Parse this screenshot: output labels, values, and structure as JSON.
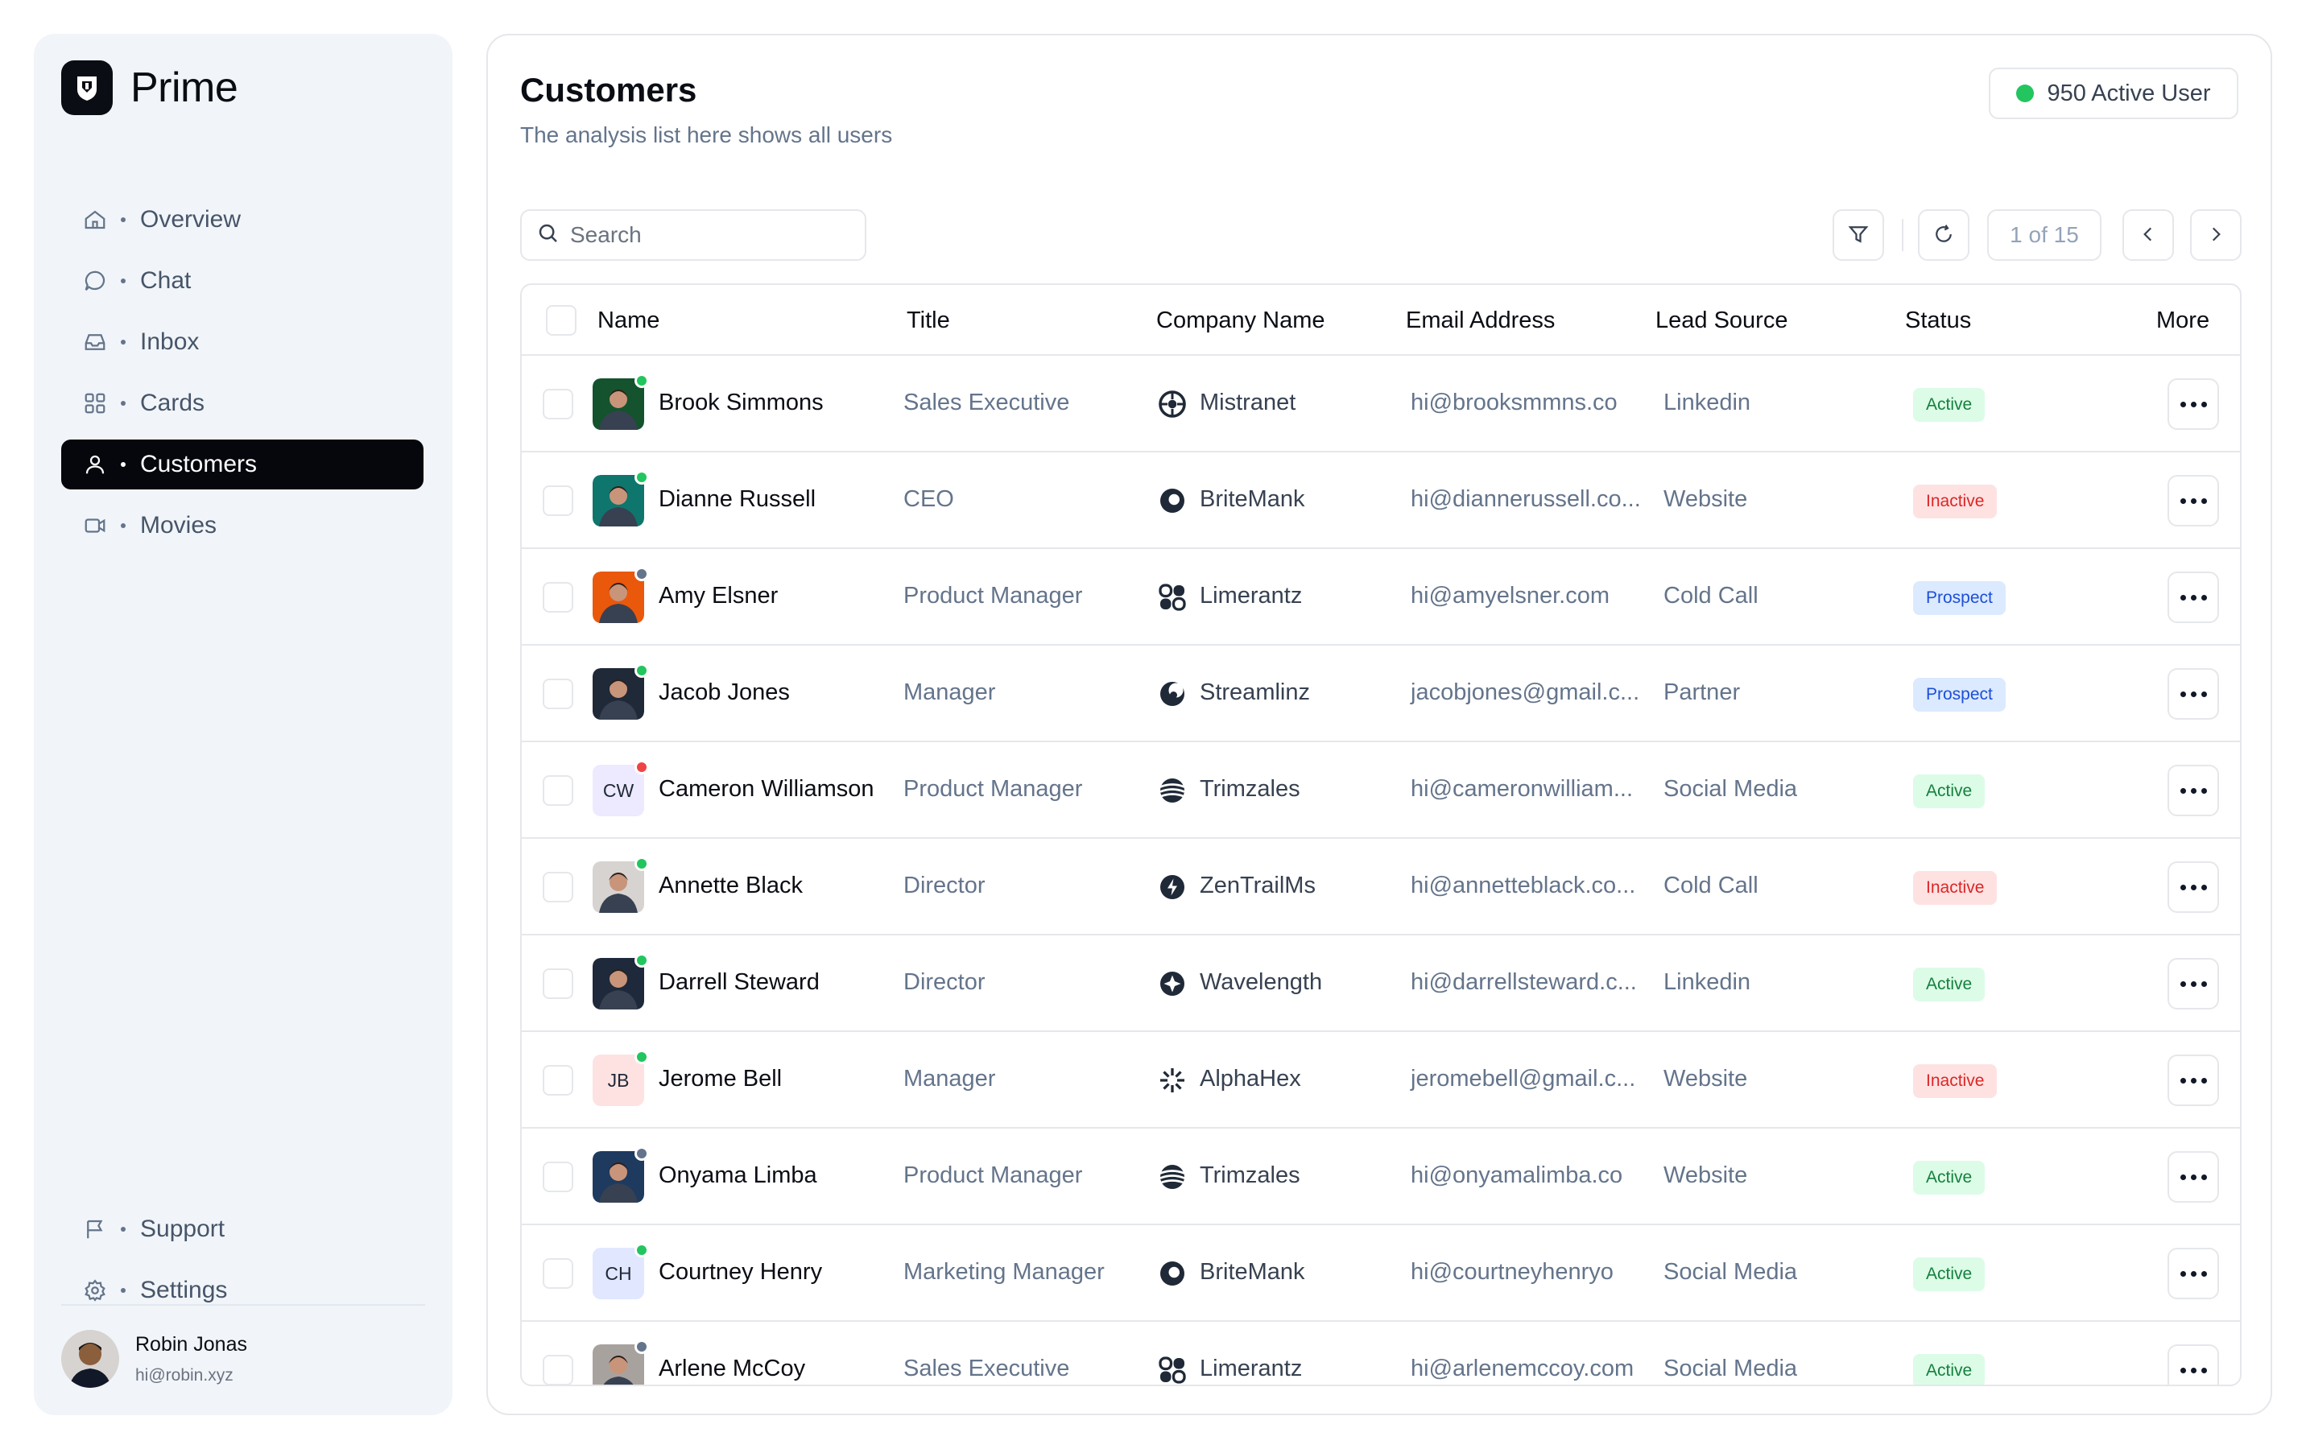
{
  "app": {
    "name": "Prime"
  },
  "sidebar": {
    "nav": [
      {
        "label": "Overview",
        "icon": "home-icon",
        "active": false
      },
      {
        "label": "Chat",
        "icon": "chat-bubble-icon",
        "active": false
      },
      {
        "label": "Inbox",
        "icon": "inbox-icon",
        "active": false
      },
      {
        "label": "Cards",
        "icon": "grid-icon",
        "active": false
      },
      {
        "label": "Customers",
        "icon": "user-icon",
        "active": true
      },
      {
        "label": "Movies",
        "icon": "video-camera-icon",
        "active": false
      }
    ],
    "bottom": [
      {
        "label": "Support",
        "icon": "flag-icon"
      },
      {
        "label": "Settings",
        "icon": "gear-icon"
      }
    ],
    "profile": {
      "name": "Robin Jonas",
      "email": "hi@robin.xyz"
    }
  },
  "header": {
    "title": "Customers",
    "subtitle": "The analysis list here shows all users",
    "active_users": "950 Active User"
  },
  "toolbar": {
    "search_placeholder": "Search",
    "pager": "1 of 15"
  },
  "table": {
    "columns": [
      "Name",
      "Title",
      "Company Name",
      "Email Address",
      "Lead Source",
      "Status",
      "More"
    ],
    "rows": [
      {
        "name": "Brook Simmons",
        "title": "Sales Executive",
        "company": "Mistranet",
        "email": "hi@brooksmmns.co",
        "lead": "Linkedin",
        "status": "Active",
        "online": "online",
        "initials": "",
        "avatar_bg": "#14532d"
      },
      {
        "name": "Dianne Russell",
        "title": "CEO",
        "company": "BriteMank",
        "email": "hi@diannerussell.co...",
        "lead": "Website",
        "status": "Inactive",
        "online": "online",
        "initials": "",
        "avatar_bg": "#0f766e"
      },
      {
        "name": "Amy Elsner",
        "title": "Product Manager",
        "company": "Limerantz",
        "email": "hi@amyelsner.com",
        "lead": "Cold Call",
        "status": "Prospect",
        "online": "away",
        "initials": "",
        "avatar_bg": "#ea580c"
      },
      {
        "name": "Jacob Jones",
        "title": "Manager",
        "company": "Streamlinz",
        "email": "jacobjones@gmail.c...",
        "lead": "Partner",
        "status": "Prospect",
        "online": "online",
        "initials": "",
        "avatar_bg": "#1f2937"
      },
      {
        "name": "Cameron Williamson",
        "title": "Product Manager",
        "company": "Trimzales",
        "email": "hi@cameronwilliam...",
        "lead": "Social Media",
        "status": "Active",
        "online": "busy",
        "initials": "CW",
        "avatar_bg": "#ede9fe"
      },
      {
        "name": "Annette Black",
        "title": "Director",
        "company": "ZenTrailMs",
        "email": "hi@annetteblack.co...",
        "lead": "Cold Call",
        "status": "Inactive",
        "online": "online",
        "initials": "",
        "avatar_bg": "#d6d3d1"
      },
      {
        "name": "Darrell Steward",
        "title": "Director",
        "company": "Wavelength",
        "email": "hi@darrellsteward.c...",
        "lead": "Linkedin",
        "status": "Active",
        "online": "online",
        "initials": "",
        "avatar_bg": "#1e293b"
      },
      {
        "name": "Jerome Bell",
        "title": "Manager",
        "company": "AlphaHex",
        "email": "jeromebell@gmail.c...",
        "lead": "Website",
        "status": "Inactive",
        "online": "online",
        "initials": "JB",
        "avatar_bg": "#fee2e2"
      },
      {
        "name": "Onyama Limba",
        "title": "Product Manager",
        "company": "Trimzales",
        "email": "hi@onyamalimba.co",
        "lead": "Website",
        "status": "Active",
        "online": "away",
        "initials": "",
        "avatar_bg": "#1e3a5f"
      },
      {
        "name": "Courtney Henry",
        "title": "Marketing Manager",
        "company": "BriteMank",
        "email": "hi@courtneyhenryo",
        "lead": "Social Media",
        "status": "Active",
        "online": "online",
        "initials": "CH",
        "avatar_bg": "#e0e7ff"
      },
      {
        "name": "Arlene McCoy",
        "title": "Sales Executive",
        "company": "Limerantz",
        "email": "hi@arlenemccoy.com",
        "lead": "Social Media",
        "status": "Active",
        "online": "away",
        "initials": "",
        "avatar_bg": "#a8a29e"
      }
    ]
  },
  "colors": {
    "online": "#22c55e",
    "away": "#64748b",
    "busy": "#ef4444",
    "accent": "#05070d"
  }
}
